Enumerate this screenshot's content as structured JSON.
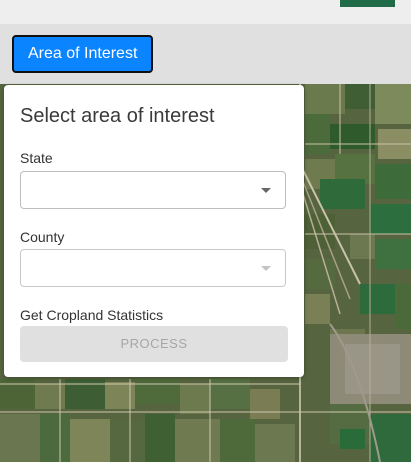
{
  "toolbar": {
    "aoi_button_label": "Area of Interest"
  },
  "panel": {
    "title": "Select area of interest",
    "state": {
      "label": "State",
      "value": ""
    },
    "county": {
      "label": "County",
      "value": ""
    },
    "stats_label": "Get Cropland Statistics",
    "process_label": "PROCESS"
  },
  "colors": {
    "accent_blue": "#0a84ff",
    "header_green": "#1f6b47",
    "disabled_gray": "#e0e0e0"
  },
  "icons": [
    "chevron-down-icon"
  ]
}
